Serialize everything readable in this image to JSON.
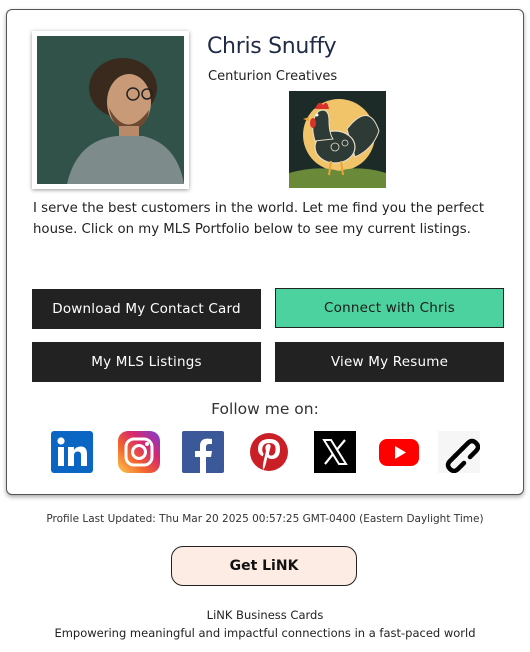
{
  "profile": {
    "name": "Chris Snuffy",
    "company": "Centurion Creatives",
    "bio": "I serve the best customers in the world. Let me find you the perfect house. Click on my MLS Portfolio below to see my current listings."
  },
  "buttons": {
    "download_contact": "Download My Contact Card",
    "connect": "Connect with Chris",
    "mls_listings": "My MLS Listings",
    "resume": "View My Resume"
  },
  "follow_label": "Follow me on:",
  "social_icons": [
    "linkedin-icon",
    "instagram-icon",
    "facebook-icon",
    "pinterest-icon",
    "x-icon",
    "youtube-icon",
    "link-icon"
  ],
  "colors": {
    "connect_button": "#4cd29e",
    "dark_button": "#222222",
    "get_link_button": "#fdece4",
    "name_text": "#1f2a44"
  },
  "updated_text": "Profile Last Updated: Thu Mar 20 2025 00:57:25 GMT-0400 (Eastern Daylight Time)",
  "get_link_label": "Get LiNK",
  "footer": {
    "brand": "LiNK Business Cards",
    "tagline": "Empowering meaningful and impactful connections in a fast-paced world"
  }
}
